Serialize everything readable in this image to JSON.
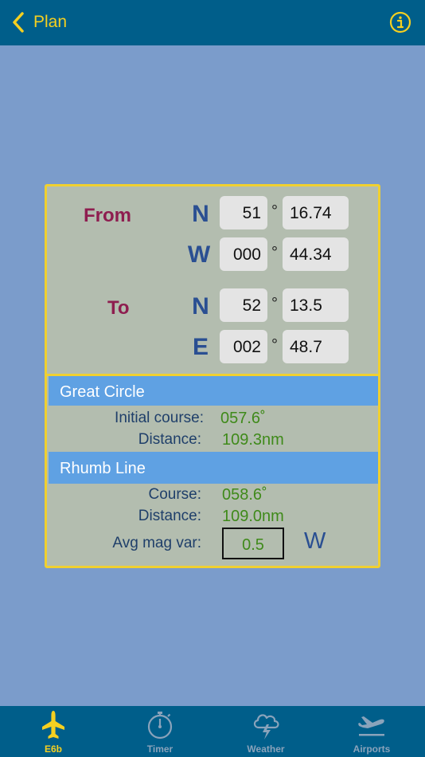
{
  "nav": {
    "back_label": "Plan",
    "info_icon": "info-icon"
  },
  "from": {
    "label": "From",
    "lat": {
      "hemi": "N",
      "deg": "51",
      "min": "16.74"
    },
    "lon": {
      "hemi": "W",
      "deg": "000",
      "min": "44.34"
    }
  },
  "to": {
    "label": "To",
    "lat": {
      "hemi": "N",
      "deg": "52",
      "min": "13.5"
    },
    "lon": {
      "hemi": "E",
      "deg": "002",
      "min": "48.7"
    }
  },
  "degree_symbol": "°",
  "great_circle": {
    "title": "Great Circle",
    "initial_course_label": "Initial course:",
    "initial_course_value": "057.6˚",
    "distance_label": "Distance:",
    "distance_value": "109.3nm"
  },
  "rhumb_line": {
    "title": "Rhumb Line",
    "course_label": "Course:",
    "course_value": "058.6˚",
    "distance_label": "Distance:",
    "distance_value": "109.0nm",
    "mag_var_label": "Avg mag var:",
    "mag_var_value": "0.5",
    "mag_var_dir": "W"
  },
  "tabs": [
    {
      "label": "E6b",
      "icon": "airplane-icon",
      "active": true
    },
    {
      "label": "Timer",
      "icon": "stopwatch-icon",
      "active": false
    },
    {
      "label": "Weather",
      "icon": "storm-cloud-icon",
      "active": false
    },
    {
      "label": "Airports",
      "icon": "departure-icon",
      "active": false
    }
  ],
  "colors": {
    "accent": "#f5d020",
    "nav_bg": "#005e8a",
    "page_bg": "#7b9ccb",
    "panel_bg": "#b3bdaf",
    "section_head": "#5fa1e3",
    "value_green": "#3f8a1a",
    "label_maroon": "#8e1d4f",
    "tab_inactive": "#8aa3bb"
  }
}
